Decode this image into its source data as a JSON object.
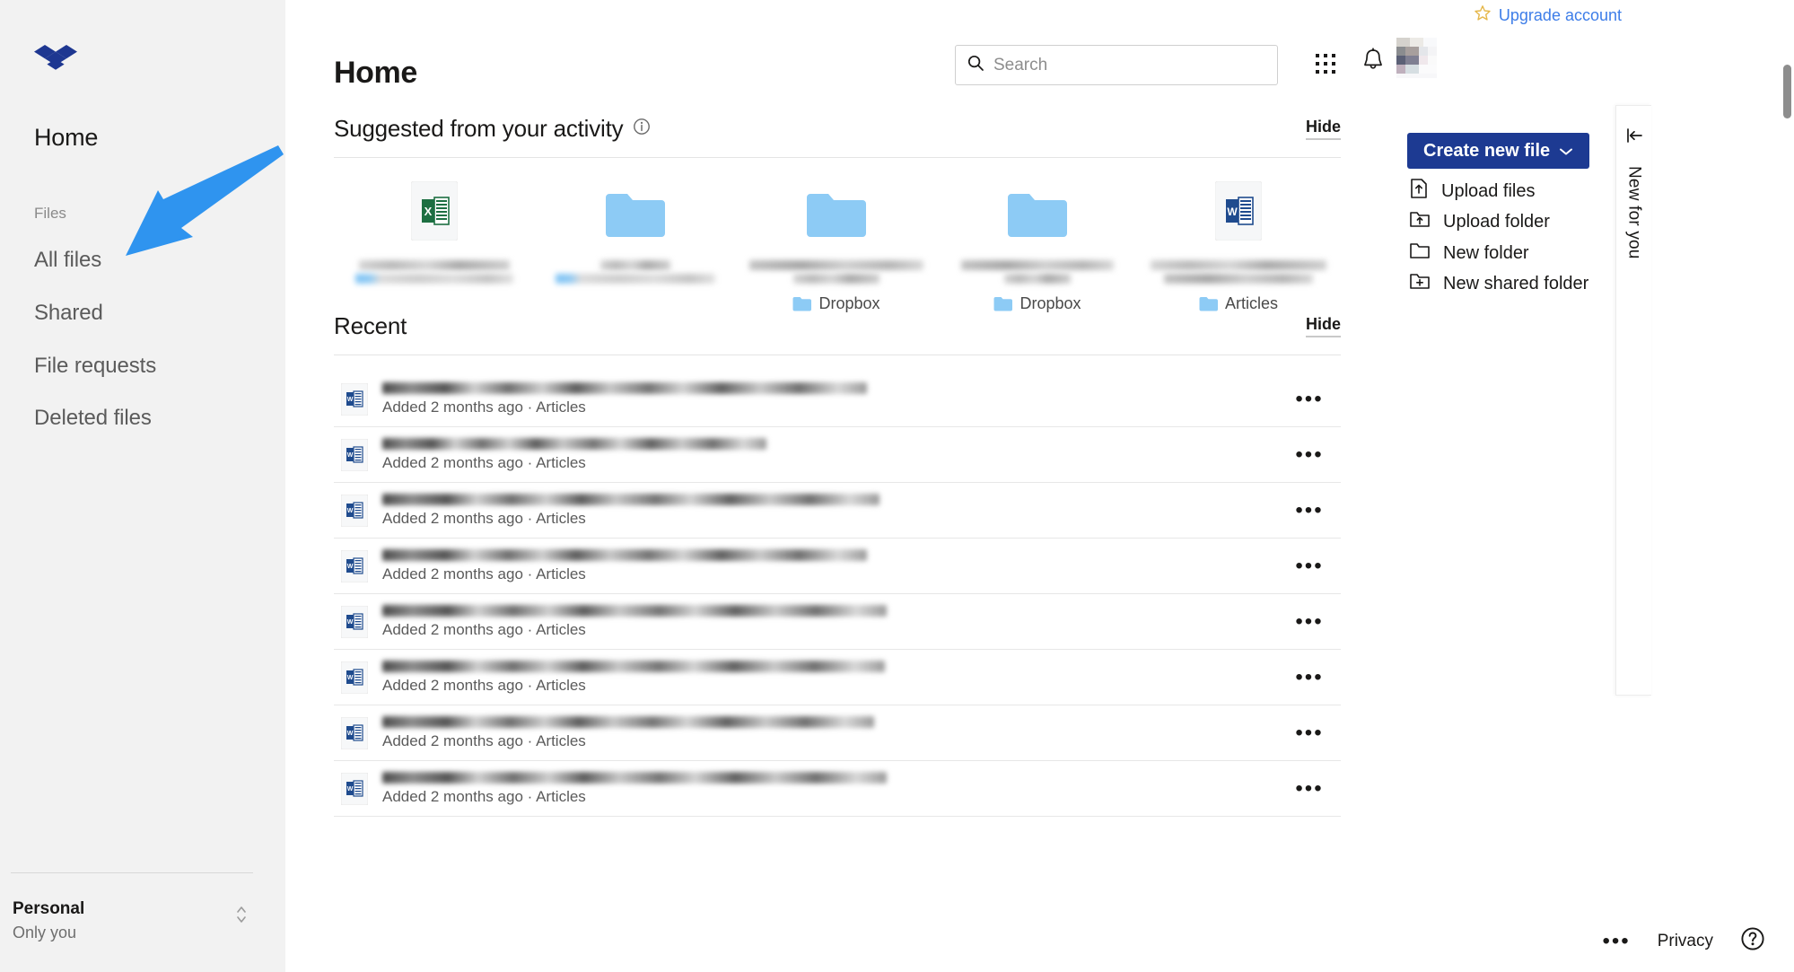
{
  "brand": {
    "logo": "dropbox-logo",
    "primary_color": "#1d3a92",
    "accent_link_color": "#3d7de8",
    "annotation_arrow_color": "#2f94ef"
  },
  "sidebar": {
    "home_label": "Home",
    "files_section_label": "Files",
    "items": [
      {
        "label": "All files",
        "icon": "files-icon"
      },
      {
        "label": "Shared",
        "icon": "shared-icon"
      },
      {
        "label": "File requests",
        "icon": "file-request-icon"
      },
      {
        "label": "Deleted files",
        "icon": "trash-icon"
      }
    ],
    "account": {
      "name": "Personal",
      "subtitle": "Only you",
      "switcher_icon": "chevron-updown-icon"
    }
  },
  "header": {
    "upgrade_label": "Upgrade account",
    "upgrade_icon": "star-icon",
    "search": {
      "placeholder": "Search",
      "value": "",
      "icon": "search-icon"
    },
    "apps_icon": "grid-apps-icon",
    "notifications_icon": "bell-icon",
    "avatar": "user-avatar"
  },
  "main": {
    "page_title": "Home",
    "suggested": {
      "title": "Suggested from your activity",
      "info_icon": "info-icon",
      "hide_label": "Hide",
      "cards": [
        {
          "thumb": "excel-file-icon",
          "name": "",
          "parent": ""
        },
        {
          "thumb": "folder-icon",
          "name": "",
          "parent": ""
        },
        {
          "thumb": "folder-icon",
          "name": "",
          "parent": "Dropbox"
        },
        {
          "thumb": "folder-icon",
          "name": "",
          "parent": "Dropbox"
        },
        {
          "thumb": "word-file-icon",
          "name": "",
          "parent": "Articles"
        }
      ]
    },
    "recent": {
      "title": "Recent",
      "hide_label": "Hide",
      "rows": [
        {
          "icon": "word-file-icon",
          "name": "",
          "meta": "Added 2 months ago · Articles",
          "menu": "•••"
        },
        {
          "icon": "word-file-icon",
          "name": "",
          "meta": "Added 2 months ago · Articles",
          "menu": "•••"
        },
        {
          "icon": "word-file-icon",
          "name": "",
          "meta": "Added 2 months ago · Articles",
          "menu": "•••"
        },
        {
          "icon": "word-file-icon",
          "name": "",
          "meta": "Added 2 months ago · Articles",
          "menu": "•••"
        },
        {
          "icon": "word-file-icon",
          "name": "",
          "meta": "Added 2 months ago · Articles",
          "menu": "•••"
        },
        {
          "icon": "word-file-icon",
          "name": "",
          "meta": "Added 2 months ago · Articles",
          "menu": "•••"
        },
        {
          "icon": "word-file-icon",
          "name": "",
          "meta": "Added 2 months ago · Articles",
          "menu": "•••"
        },
        {
          "icon": "word-file-icon",
          "name": "",
          "meta": "Added 2 months ago · Articles",
          "menu": "•••"
        }
      ]
    }
  },
  "right_rail": {
    "create_button": {
      "label": "Create new file",
      "caret_icon": "chevron-down-icon"
    },
    "actions": [
      {
        "label": "Upload files",
        "icon": "upload-file-icon"
      },
      {
        "label": "Upload folder",
        "icon": "upload-folder-icon"
      },
      {
        "label": "New folder",
        "icon": "folder-outline-icon"
      },
      {
        "label": "New shared folder",
        "icon": "folder-plus-icon"
      }
    ]
  },
  "new_for_you_panel": {
    "label": "New for you",
    "collapse_icon": "collapse-left-icon"
  },
  "footer": {
    "more_label": "•••",
    "privacy_label": "Privacy",
    "help_icon": "help-circle-icon"
  }
}
